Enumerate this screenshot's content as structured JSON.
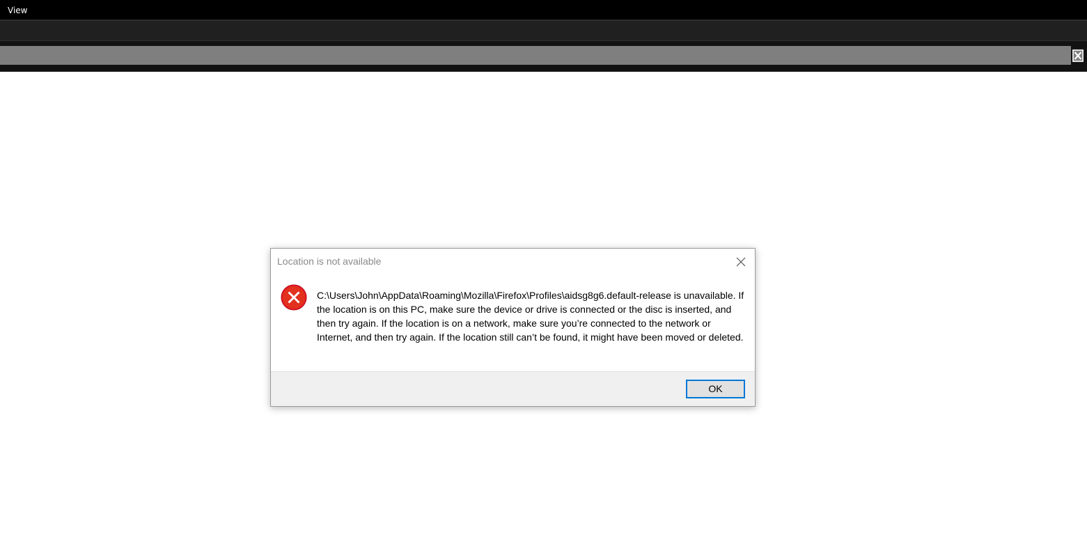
{
  "menubar": {
    "items": [
      {
        "label": "View"
      }
    ]
  },
  "addressbar": {
    "close_icon": "close-box-icon"
  },
  "dialog": {
    "title": "Location is not available",
    "close_icon": "close-icon",
    "icon": "error-icon",
    "message": "C:\\Users\\John\\AppData\\Roaming\\Mozilla\\Firefox\\Profiles\\aidsg8g6.default-release is unavailable. If the location is on this PC, make sure the device or drive is connected or the disc is inserted, and then try again. If the location is on a network, make sure you’re connected to the network or Internet, and then try again. If the location still can’t be found, it might have been moved or deleted.",
    "ok_label": "OK"
  },
  "colors": {
    "menubar_bg": "#000000",
    "toolbar_bg": "#202020",
    "addressbar_bg": "#7f7f7f",
    "error_red": "#e81123",
    "accent_blue": "#0078d7",
    "footer_bg": "#f0f0f0"
  }
}
